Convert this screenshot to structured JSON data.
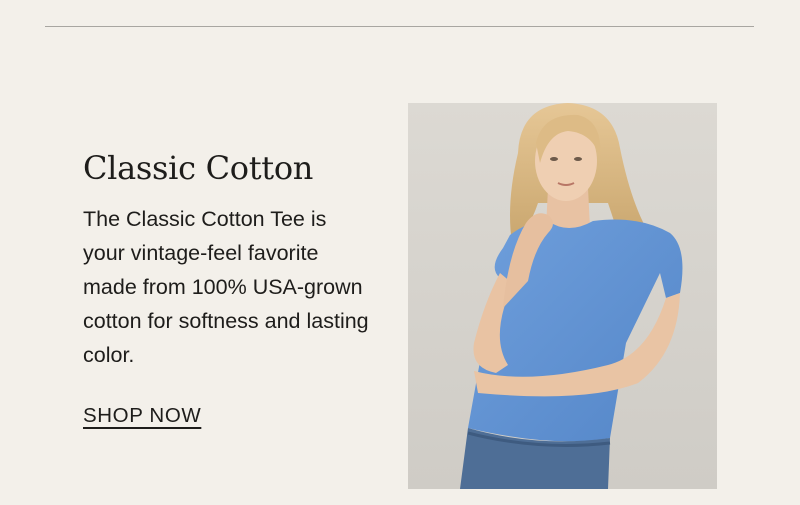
{
  "promo": {
    "title": "Classic Cotton",
    "description": "The Classic Cotton Tee is your vintage-feel favorite made from 100% USA-grown cotton for softness and lasting color.",
    "cta_label": "SHOP NOW"
  },
  "colors": {
    "background": "#f3f0ea",
    "tee": "#6192d3",
    "jeans": "#4e6e96"
  },
  "image": {
    "subject": "model-in-blue-classic-cotton-tee"
  }
}
